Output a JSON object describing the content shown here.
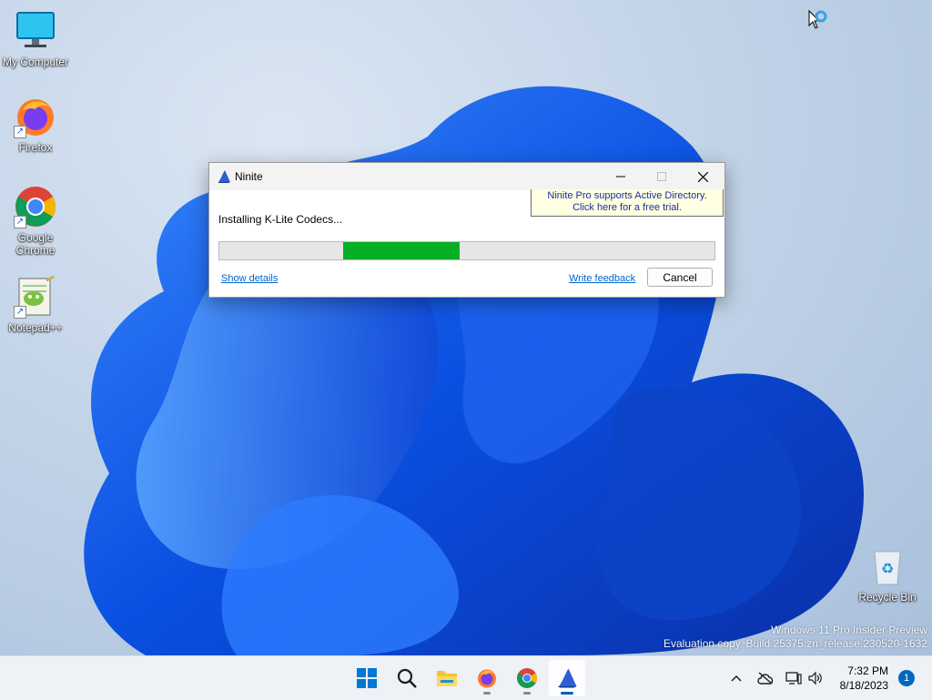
{
  "desktop": {
    "icons": [
      {
        "label": "My Computer"
      },
      {
        "label": "Firefox"
      },
      {
        "label": "Google Chrome"
      },
      {
        "label": "Notepad++"
      },
      {
        "label": "Recycle Bin"
      }
    ],
    "watermark": {
      "line1": "Windows 11 Pro Insider Preview",
      "line2": "Evaluation copy. Build 25375.zn_release.230520-1632"
    }
  },
  "window": {
    "title": "Ninite",
    "promo_line1": "Ninite Pro supports Active Directory.",
    "promo_line2": "Click here for a free trial.",
    "status": "Installing K-Lite Codecs...",
    "progress_start_fraction": 0.25,
    "progress_end_fraction": 0.485,
    "progress_color": "#06b025",
    "show_details": "Show details",
    "write_feedback": "Write feedback",
    "cancel": "Cancel"
  },
  "taskbar": {
    "items": [
      "start-icon",
      "search-icon",
      "file-explorer-icon",
      "firefox-icon",
      "chrome-icon",
      "ninite-icon"
    ],
    "time": "7:32 PM",
    "date": "8/18/2023",
    "notification_count": "1"
  }
}
